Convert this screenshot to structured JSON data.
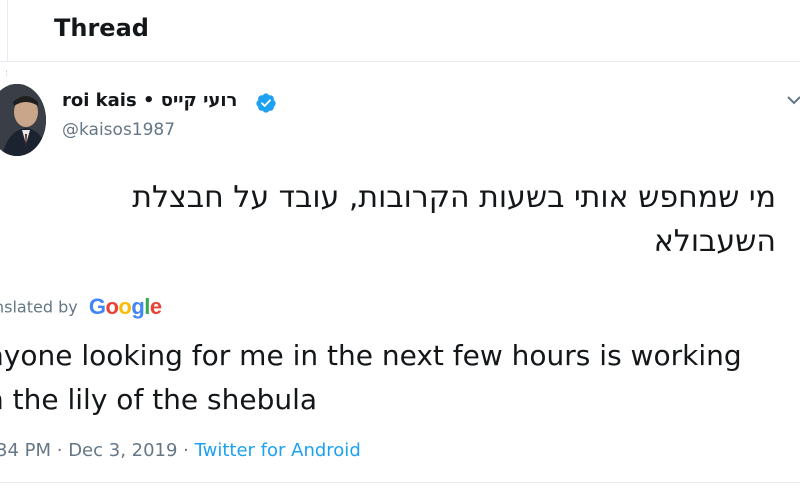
{
  "header": {
    "title": "Thread"
  },
  "tweet": {
    "author_name": "roi kais • רועי קייס",
    "handle": "@kaisos1987",
    "verified": true,
    "text_line1": "מי שמחפש אותי בשעות הקרובות, עובד על חבצלת",
    "text_line2": "השעבולא",
    "translated_by_label": "nslated by",
    "translation_provider": "Google",
    "translation": "nyone looking for me in the next few hours is working\nn the lily of the shebula",
    "time": "34 PM",
    "separator": " · ",
    "date": "Dec 3, 2019",
    "source": "Twitter for Android"
  },
  "icons": {
    "verified": "verified-badge-icon",
    "more": "chevron-down-icon",
    "avatar": "profile-avatar"
  },
  "colors": {
    "accent": "#1da1f2",
    "text": "#14171a",
    "secondary": "#657786",
    "divider": "#e6ecf0"
  }
}
